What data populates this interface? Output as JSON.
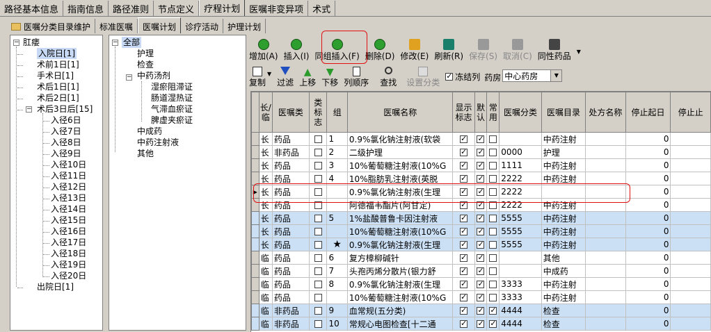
{
  "top_tabs": [
    "路径基本信息",
    "指南信息",
    "路径准则",
    "节点定义",
    "疗程计划",
    "医嘱非变异项",
    "术式"
  ],
  "sub_tabs": [
    "医嘱分类目录维护",
    "标准医嘱",
    "医嘱计划",
    "诊疗活动",
    "护理计划"
  ],
  "tree1": {
    "root": "肛瘘",
    "items": [
      "入院日[1]",
      "术前1日[1]",
      "手术日[1]",
      "术后1日[1]",
      "术后2日[1]",
      "术后3日后[15]",
      "入径6日",
      "入径7日",
      "入径8日",
      "入径9日",
      "入径10日",
      "入径11日",
      "入径12日",
      "入径13日",
      "入径14日",
      "入径15日",
      "入径16日",
      "入径17日",
      "入径18日",
      "入径19日",
      "入径20日",
      "出院日[1]"
    ]
  },
  "tree2": {
    "root": "全部",
    "items": [
      "护理",
      "检查",
      "中药汤剂",
      "湿瘀阻滞证",
      "肠道湿热证",
      "气滞血瘀证",
      "脾虚夹瘀证",
      "中成药",
      "中药注射液",
      "其他"
    ]
  },
  "toolbar1": [
    {
      "label": "增加(A)",
      "icon": "add-icon",
      "color": "#2e9e2e"
    },
    {
      "label": "插入(I)",
      "icon": "insert-icon",
      "color": "#2e9e2e"
    },
    {
      "label": "同组插入(F)",
      "icon": "group-insert-icon",
      "color": "#2e9e2e"
    },
    {
      "label": "删除(D)",
      "icon": "delete-icon",
      "color": "#2e9e2e"
    },
    {
      "label": "修改(E)",
      "icon": "edit-icon",
      "color": "#e0a020"
    },
    {
      "label": "刷新(R)",
      "icon": "refresh-icon",
      "color": "#1a7f6a"
    },
    {
      "label": "保存(S)",
      "icon": "save-icon",
      "color": "#999999"
    },
    {
      "label": "取消(C)",
      "icon": "cancel-icon",
      "color": "#999999"
    },
    {
      "label": "同性药品",
      "icon": "same-drug-icon",
      "color": "#444444"
    }
  ],
  "toolbar2": {
    "copy": "复制",
    "filter": "过滤",
    "up": "上移",
    "down": "下移",
    "column_order": "列顺序",
    "search": "查找",
    "set_category": "设置分类",
    "freeze": "冻结列",
    "pharmacy_label": "药房",
    "pharmacy_value": "中心药房"
  },
  "grid": {
    "headers": [
      "长/临",
      "医嘱类",
      "类标志",
      "组",
      "医嘱名称",
      "显示标志",
      "默认",
      "常用",
      "医嘱分类",
      "医嘱目录",
      "处方名称",
      "停止起日",
      "停止止"
    ],
    "rows": [
      {
        "type": "长",
        "cls": "药品",
        "flag": false,
        "group": "1",
        "name": "0.9%氯化钠注射液(软袋",
        "show": true,
        "def": true,
        "common": false,
        "cat": "",
        "dir": "中药注射",
        "presc": "",
        "stop": "0",
        "blue": false
      },
      {
        "type": "长",
        "cls": "非药品",
        "flag": false,
        "group": "2",
        "name": "二级护理",
        "show": true,
        "def": true,
        "common": false,
        "cat": "0000",
        "dir": "护理",
        "presc": "",
        "stop": "0",
        "blue": false
      },
      {
        "type": "长",
        "cls": "药品",
        "flag": false,
        "group": "3",
        "name": "10%葡萄糖注射液(10%G",
        "show": true,
        "def": true,
        "common": false,
        "cat": "1111",
        "dir": "中药注射",
        "presc": "",
        "stop": "0",
        "blue": false
      },
      {
        "type": "长",
        "cls": "药品",
        "flag": false,
        "group": "4",
        "name": "10%脂肪乳注射液(英脱",
        "show": true,
        "def": true,
        "common": false,
        "cat": "2222",
        "dir": "中药注射",
        "presc": "",
        "stop": "0",
        "blue": false
      },
      {
        "type": "长",
        "cls": "药品",
        "flag": false,
        "group": "",
        "name": "0.9%氯化钠注射液(生理",
        "show": true,
        "def": true,
        "common": false,
        "cat": "2222",
        "dir": "",
        "presc": "",
        "stop": "0",
        "blue": false,
        "current": true
      },
      {
        "type": "长",
        "cls": "药品",
        "flag": false,
        "group": "",
        "name": "阿德福韦酯片(阿甘定)",
        "show": true,
        "def": true,
        "common": false,
        "cat": "2222",
        "dir": "中药注射",
        "presc": "",
        "stop": "0",
        "blue": false
      },
      {
        "type": "长",
        "cls": "药品",
        "flag": false,
        "group": "5",
        "name": "1%盐酸普鲁卡因注射液",
        "show": true,
        "def": true,
        "common": false,
        "cat": "5555",
        "dir": "中药注射",
        "presc": "",
        "stop": "0",
        "blue": true
      },
      {
        "type": "长",
        "cls": "药品",
        "flag": false,
        "group": "",
        "name": "10%葡萄糖注射液(10%G",
        "show": true,
        "def": true,
        "common": false,
        "cat": "5555",
        "dir": "中药注射",
        "presc": "",
        "stop": "0",
        "blue": true
      },
      {
        "type": "长",
        "cls": "药品",
        "flag": false,
        "group": "★",
        "name": "0.9%氯化钠注射液(生理",
        "show": true,
        "def": true,
        "common": false,
        "cat": "5555",
        "dir": "中药注射",
        "presc": "",
        "stop": "0",
        "blue": true
      },
      {
        "type": "临",
        "cls": "药品",
        "flag": false,
        "group": "6",
        "name": "复方樟柳碱针",
        "show": true,
        "def": true,
        "common": false,
        "cat": "",
        "dir": "其他",
        "presc": "",
        "stop": "0",
        "blue": false
      },
      {
        "type": "临",
        "cls": "药品",
        "flag": false,
        "group": "7",
        "name": "头孢丙烯分散片(银力舒",
        "show": true,
        "def": true,
        "common": false,
        "cat": "",
        "dir": "中成药",
        "presc": "",
        "stop": "0",
        "blue": false
      },
      {
        "type": "临",
        "cls": "药品",
        "flag": false,
        "group": "8",
        "name": "0.9%氯化钠注射液(生理",
        "show": true,
        "def": true,
        "common": false,
        "cat": "3333",
        "dir": "中药注射",
        "presc": "",
        "stop": "0",
        "blue": false
      },
      {
        "type": "临",
        "cls": "药品",
        "flag": false,
        "group": "",
        "name": "10%葡萄糖注射液(10%G",
        "show": true,
        "def": true,
        "common": false,
        "cat": "3333",
        "dir": "中药注射",
        "presc": "",
        "stop": "0",
        "blue": false
      },
      {
        "type": "临",
        "cls": "非药品",
        "flag": false,
        "group": "9",
        "name": "血常规(五分类)",
        "show": true,
        "def": true,
        "common": true,
        "cat": "4444",
        "dir": "检查",
        "presc": "",
        "stop": "0",
        "blue": true
      },
      {
        "type": "临",
        "cls": "非药品",
        "flag": false,
        "group": "10",
        "name": "常规心电图检查[十二通",
        "show": true,
        "def": true,
        "common": true,
        "cat": "4444",
        "dir": "检查",
        "presc": "",
        "stop": "0",
        "blue": true
      }
    ]
  }
}
